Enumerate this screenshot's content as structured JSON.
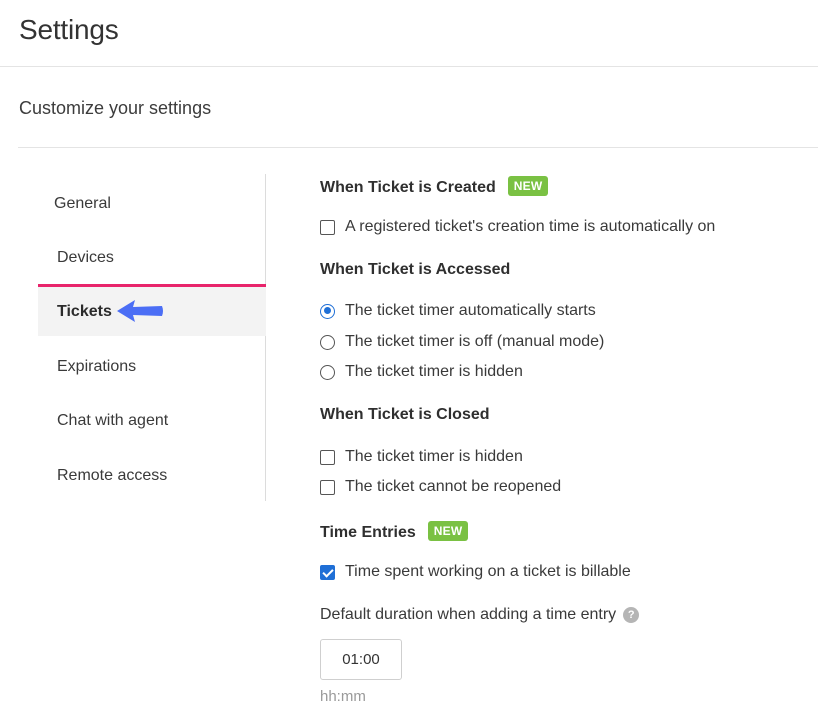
{
  "header": {
    "title": "Settings"
  },
  "subtitle": "Customize your settings",
  "nav": {
    "items": [
      {
        "label": "General"
      },
      {
        "label": "Devices"
      },
      {
        "label": "Tickets"
      },
      {
        "label": "Expirations"
      },
      {
        "label": "Chat with agent"
      },
      {
        "label": "Remote access"
      }
    ],
    "active": "Tickets",
    "accent_color": "#e8246b",
    "arrow_color": "#4b6ef5"
  },
  "sections": {
    "created": {
      "title": "When Ticket is Created",
      "badge": "NEW",
      "options": [
        {
          "label": "A registered ticket's creation time is automatically on",
          "checked": false
        }
      ]
    },
    "accessed": {
      "title": "When Ticket is Accessed",
      "options": [
        {
          "label": "The ticket timer automatically starts",
          "selected": true
        },
        {
          "label": "The ticket timer is off (manual mode)",
          "selected": false
        },
        {
          "label": "The ticket timer is hidden",
          "selected": false
        }
      ]
    },
    "closed": {
      "title": "When Ticket is Closed",
      "options": [
        {
          "label": "The ticket timer is hidden",
          "checked": false
        },
        {
          "label": "The ticket cannot be reopened",
          "checked": false
        }
      ]
    },
    "time_entries": {
      "title": "Time Entries",
      "badge": "NEW",
      "options": [
        {
          "label": "Time spent working on a ticket is billable",
          "checked": true
        }
      ],
      "duration_label": "Default duration when adding a time entry",
      "help_icon": "?",
      "duration_value": "01:00",
      "duration_hint": "hh:mm"
    }
  },
  "colors": {
    "badge": "#7ac143",
    "checked": "#1f6fd6"
  }
}
